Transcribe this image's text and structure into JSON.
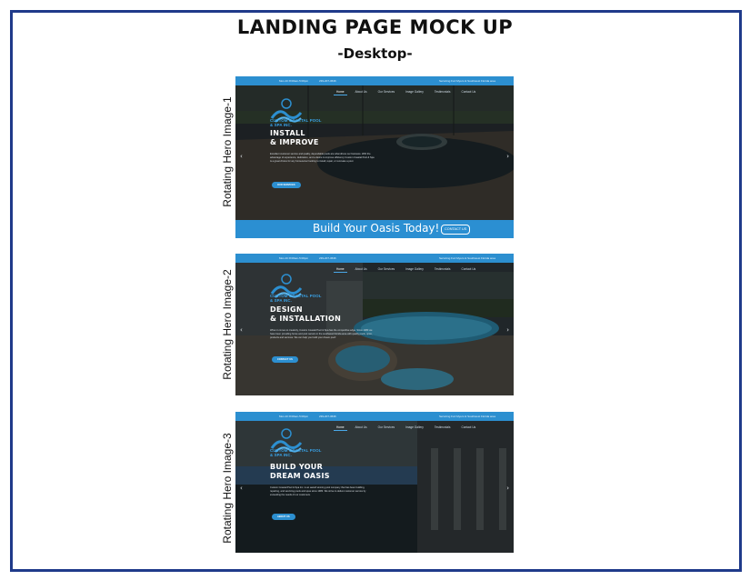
{
  "header": {
    "title": "LANDING PAGE MOCK UP",
    "subtitle": "-Desktop-"
  },
  "topbar": {
    "hours": "Mon-Fri 8:00am-5:00pm",
    "phone": "239-207-3636",
    "service_area": "Servicing Fort Myers & Southwest Florida area"
  },
  "nav": {
    "items": [
      "Home",
      "About Us",
      "Our Services",
      "Image Gallery",
      "Testimonials",
      "Contact Us"
    ]
  },
  "brand": {
    "line1": "CUSTOM COASTAL POOL",
    "line2": "& SPA INC."
  },
  "slides": [
    {
      "label": "Rotating Hero Image-1",
      "headline1": "INSTALL",
      "headline2": "& IMPROVE",
      "body": "Excellent customer service and quality, dependable pools are what drives our business. With the advantage of experience, dedication, and a desire to improve efficiency Custom Coastal Pool & Spa is a great choice for any homeowner looking to install, repair, or renovate a pool.",
      "button": "OUR SERVICES",
      "cta_text": "Build Your Oasis Today!",
      "cta_button": "CONTACT US"
    },
    {
      "label": "Rotating Hero Image-2",
      "headline1": "DESIGN",
      "headline2": "& INSTALLATION",
      "body": "When it comes to creativity, Custom Coastal Pool & Spa has the competitive edge. Since 1983 we have been providing home and pool owners in the southwest Florida area with quality pools, spas, products and services. We can help you build your dream pool!",
      "button": "CONTACT US"
    },
    {
      "label": "Rotating Hero Image-3",
      "headline1": "BUILD YOUR",
      "headline2": "DREAM OASIS",
      "body": "Custom Coastal Pool & Spa Inc. is an award winning pool company that has been building, repairing, and servicing pools and spas since 1983. We strive to deliver customer service by exceeding the needs of our customers.",
      "button": "ABOUT US"
    }
  ],
  "colors": {
    "frame": "#1f3a8a",
    "accent": "#2c8fd0",
    "brand_text": "#3aa3e8"
  },
  "icons": [
    "chevron-left-icon",
    "chevron-right-icon",
    "clock-icon",
    "phone-icon",
    "wave-logo-icon"
  ]
}
